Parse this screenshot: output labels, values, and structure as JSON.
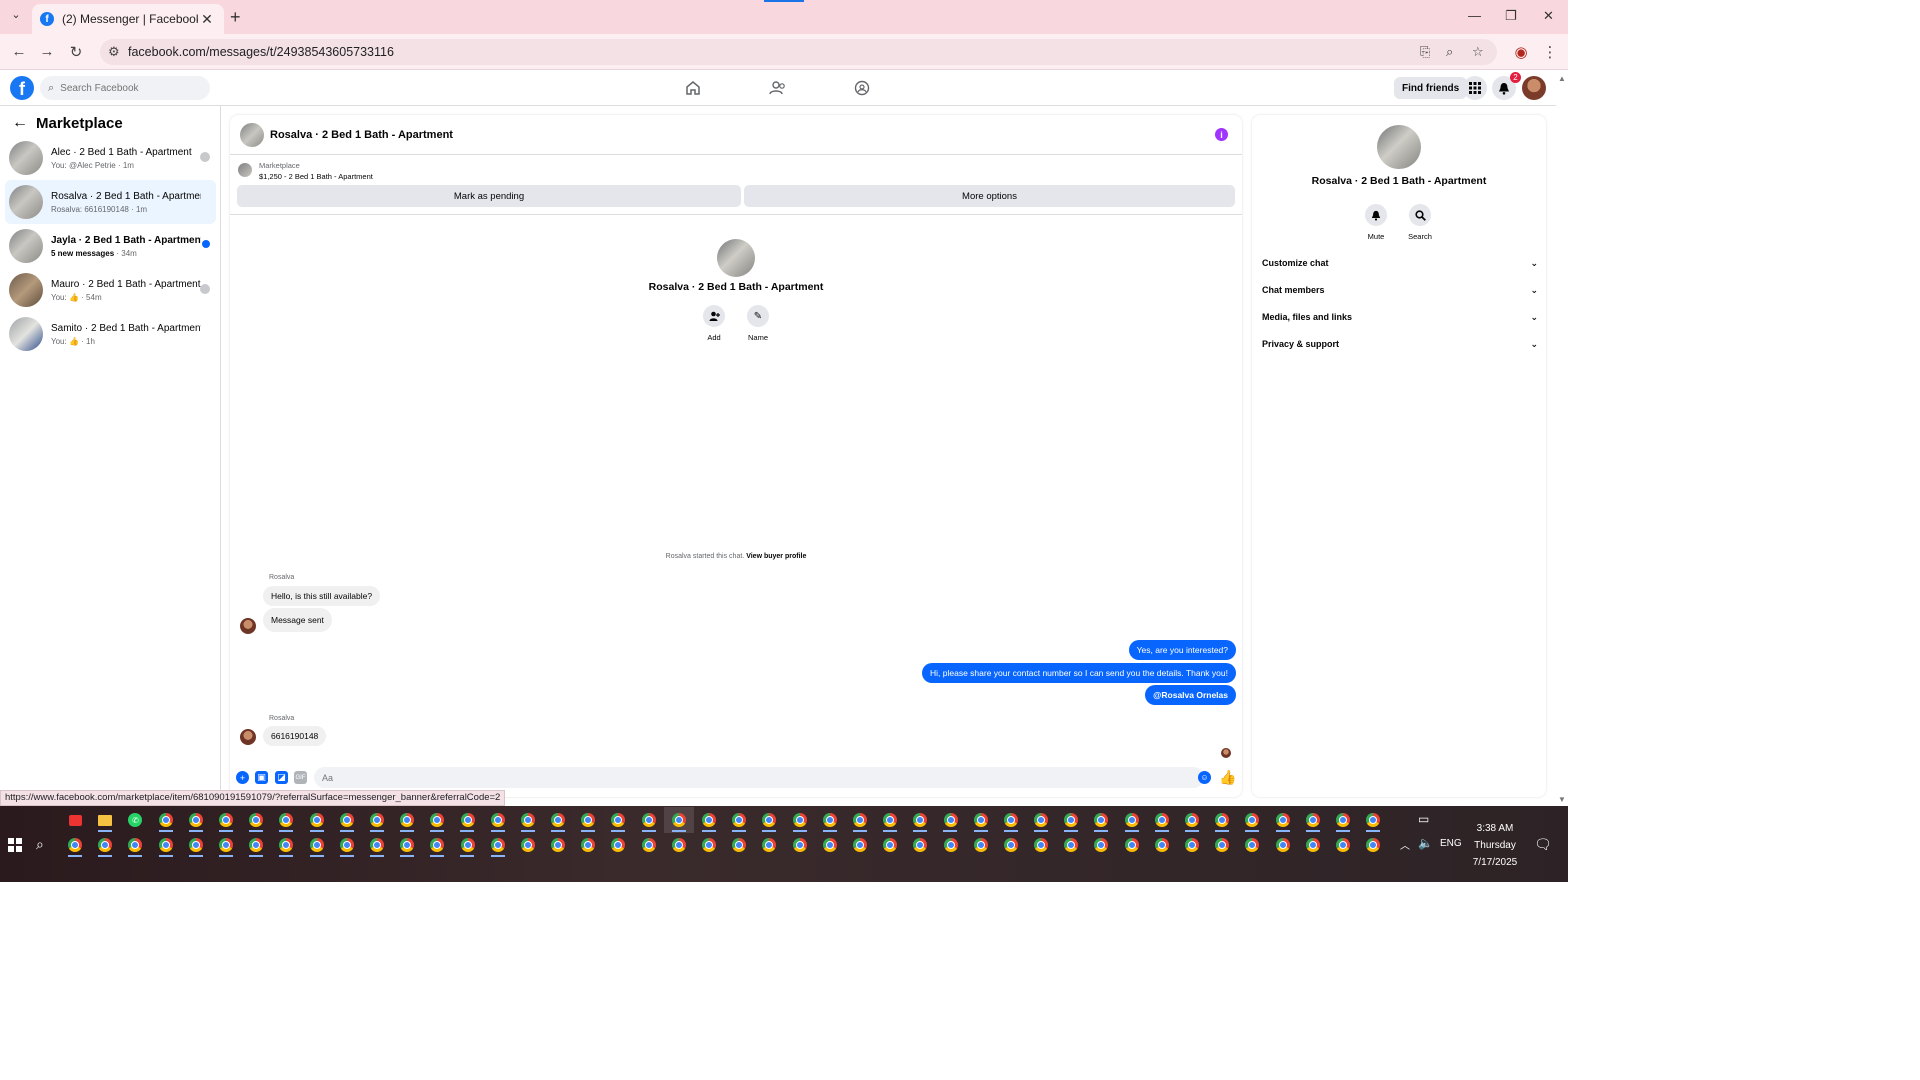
{
  "browser": {
    "tab_title": "(2) Messenger | Facebook",
    "url": "facebook.com/messages/t/24938543605733116",
    "status_url": "https://www.facebook.com/marketplace/item/681090191591079/?referralSurface=messenger_banner&referralCode=2"
  },
  "fb_nav": {
    "search_placeholder": "Search Facebook",
    "find_friends": "Find friends",
    "notification_count": "2"
  },
  "sidebar": {
    "title": "Marketplace",
    "conversations": [
      {
        "title": "Alec · 2 Bed 1 Bath - Apartment",
        "subtitle": "You: @Alec Petrie · 1m",
        "indicator": "avatar"
      },
      {
        "title": "Rosalva · 2 Bed 1 Bath - Apartment",
        "subtitle": "Rosalva: 6616190148 · 1m",
        "indicator": "none"
      },
      {
        "title": "Jayla · 2 Bed 1 Bath - Apartment",
        "subtitle_bold": "5 new messages",
        "subtitle_time": " · 34m",
        "indicator": "unread"
      },
      {
        "title": "Mauro · 2 Bed 1 Bath - Apartment",
        "subtitle_prefix": "You:",
        "subtitle_time": " · 54m",
        "indicator": "avatar"
      },
      {
        "title": "Samito · 2 Bed 1 Bath - Apartment",
        "subtitle_prefix": "You:",
        "subtitle_time": " · 1h",
        "indicator": "none"
      }
    ]
  },
  "chat": {
    "header_title": "Rosalva · 2 Bed 1 Bath - Apartment",
    "listing_source": "Marketplace",
    "listing_price_title": "$1,250 - 2 Bed 1 Bath - Apartment",
    "mark_pending": "Mark as pending",
    "more_options": "More options",
    "intro_title": "Rosalva · 2 Bed 1 Bath - Apartment",
    "add_label": "Add",
    "name_label": "Name",
    "started_text": "Rosalva started this chat. ",
    "view_buyer_profile": "View buyer profile",
    "messages": {
      "sender_1": "Rosalva",
      "in_1": "Hello, is this still available?",
      "in_2": "Message sent",
      "out_1": "Yes, are you interested?",
      "out_2": "Hi, please share your contact number so I can send you the details. Thank you!",
      "out_3": "@Rosalva Ornelas",
      "sender_2": "Rosalva",
      "in_3": "6616190148"
    },
    "composer_placeholder": "Aa"
  },
  "info_panel": {
    "title": "Rosalva · 2 Bed 1 Bath - Apartment",
    "mute_label": "Mute",
    "search_label": "Search",
    "sections": [
      "Customize chat",
      "Chat members",
      "Media, files and links",
      "Privacy & support"
    ]
  },
  "taskbar": {
    "time": "3:38 AM",
    "day": "Thursday",
    "date": "7/17/2025",
    "language": "ENG"
  },
  "colors": {
    "fb_blue": "#1877f2",
    "messenger_blue": "#0866ff",
    "browser_tab_bg": "#f8d7de",
    "info_purple": "#a033ff"
  }
}
